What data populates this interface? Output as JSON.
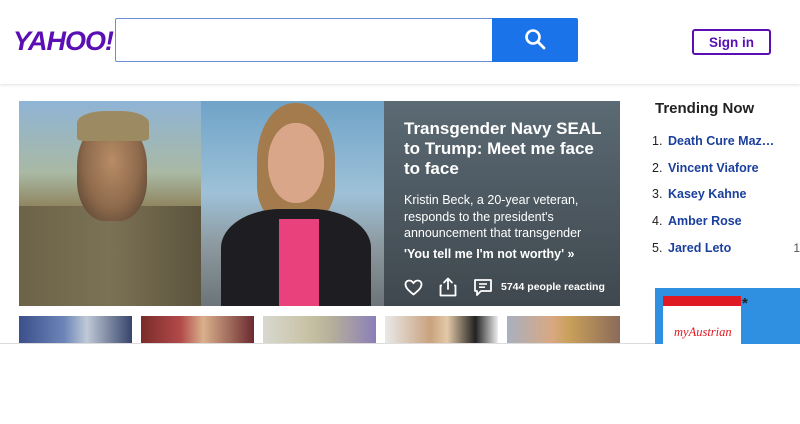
{
  "header": {
    "logo_text": "YAHOO!",
    "search": {
      "value": "",
      "placeholder": ""
    },
    "signin_label": "Sign in"
  },
  "hero": {
    "title": "Transgender Navy SEAL to Trump: Meet me face to face",
    "description": "Kristin Beck, a 20-year veteran, responds to the president's announcement that transgender",
    "quote": "'You tell me I'm not worthy' »",
    "reacting": "5744 people reacting"
  },
  "trending": {
    "title": "Trending Now",
    "items": [
      {
        "num": "1.",
        "label": "Death Cure Maze ...",
        "extra": ""
      },
      {
        "num": "2.",
        "label": "Vincent Viafore",
        "extra": ""
      },
      {
        "num": "3.",
        "label": "Kasey Kahne",
        "extra": ""
      },
      {
        "num": "4.",
        "label": "Amber Rose",
        "extra": ""
      },
      {
        "num": "5.",
        "label": "Jared Leto",
        "extra": "1"
      }
    ]
  },
  "ad": {
    "brand_text": "myAustrian",
    "star": "*"
  },
  "colors": {
    "brand_purple": "#5a0fb4",
    "search_blue": "#1a73e8",
    "trending_link": "#1a3f9c"
  },
  "icons": [
    "search-icon",
    "heart-icon",
    "share-icon",
    "comment-icon"
  ]
}
